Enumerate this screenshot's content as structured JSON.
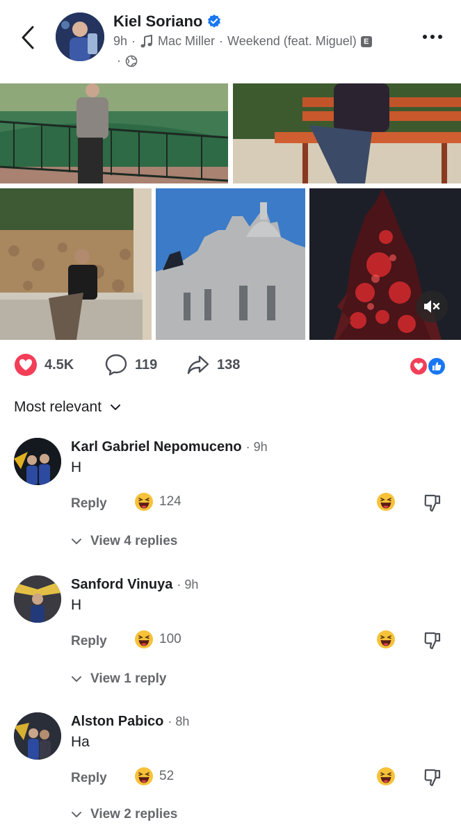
{
  "post": {
    "author": "Kiel Soriano",
    "time": "9h",
    "separator": "·",
    "music_artist": "Mac Miller",
    "music_title": "Weekend (feat. Miguel)",
    "explicit_badge": "E"
  },
  "stats": {
    "reactions": "4.5K",
    "comments": "119",
    "shares": "138"
  },
  "sort_label": "Most relevant",
  "comments": [
    {
      "name": "Karl Gabriel Nepomuceno",
      "time": "· 9h",
      "text": "H",
      "reply_label": "Reply",
      "reaction_count": "124",
      "view_replies": "View 4 replies"
    },
    {
      "name": "Sanford Vinuya",
      "time": "· 9h",
      "text": "H",
      "reply_label": "Reply",
      "reaction_count": "100",
      "view_replies": "View 1 reply"
    },
    {
      "name": "Alston Pabico",
      "time": "· 8h",
      "text": "Ha",
      "reply_label": "Reply",
      "reaction_count": "52",
      "view_replies": "View 2 replies"
    }
  ],
  "colors": {
    "love": "#f33e58",
    "like": "#1877f2",
    "secondary_text": "#65676b"
  }
}
